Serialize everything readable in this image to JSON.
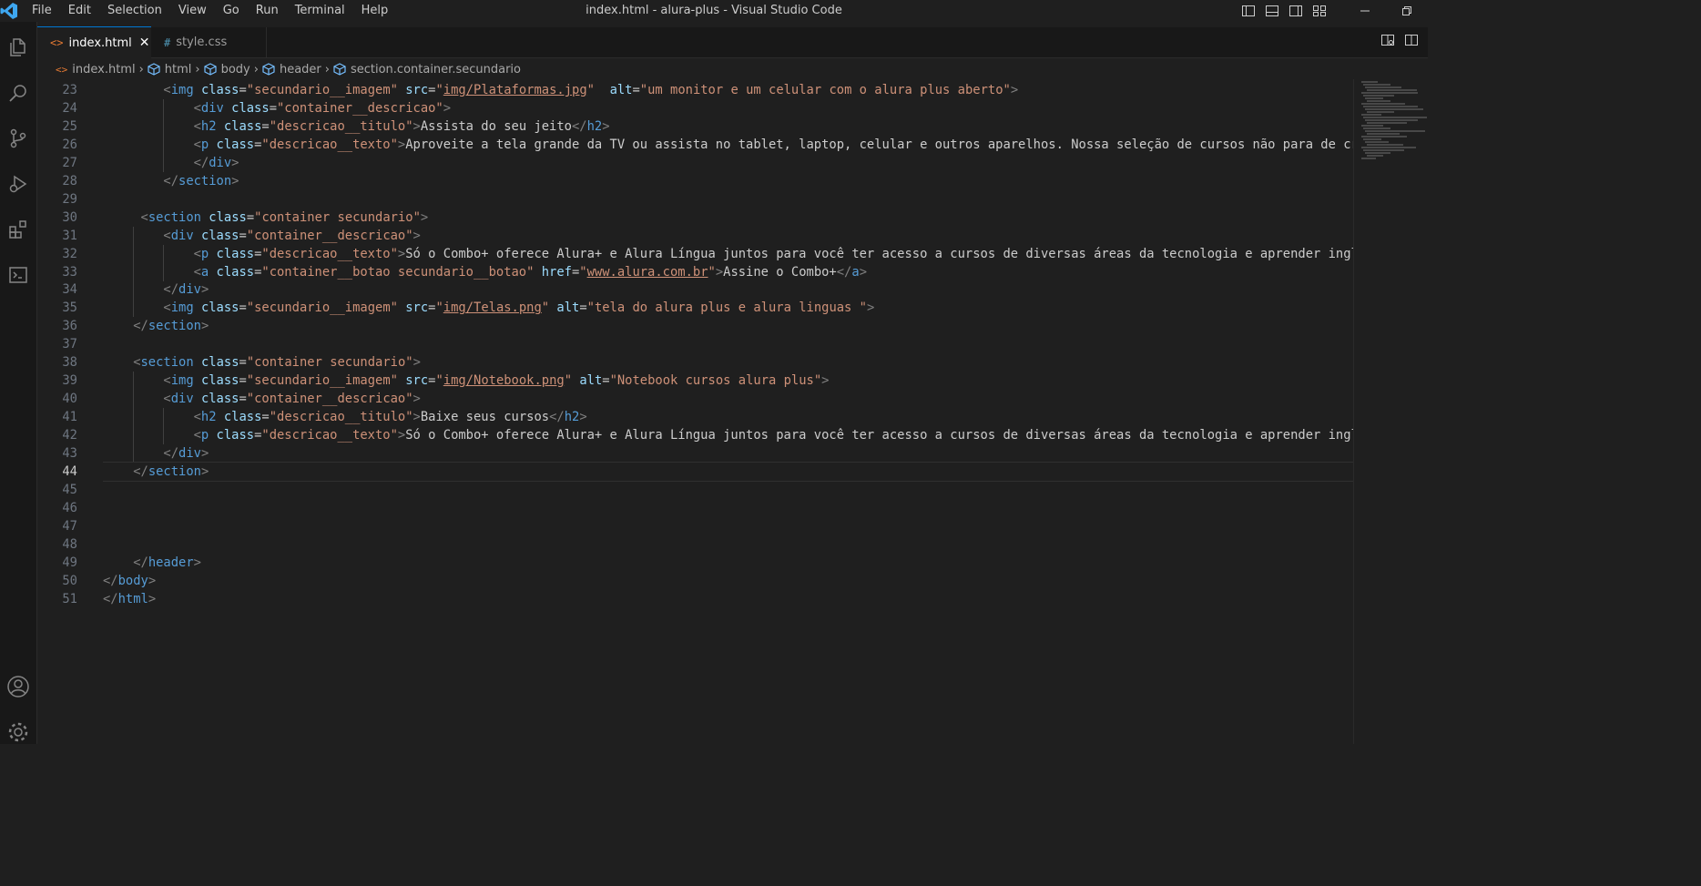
{
  "window": {
    "title": "index.html - alura-plus - Visual Studio Code"
  },
  "menu": [
    "File",
    "Edit",
    "Selection",
    "View",
    "Go",
    "Run",
    "Terminal",
    "Help"
  ],
  "tabs": [
    {
      "label": "index.html",
      "icon": "<>",
      "active": true
    },
    {
      "label": "style.css",
      "icon": "#",
      "active": false
    }
  ],
  "breadcrumbs": [
    "index.html",
    "html",
    "body",
    "header",
    "section.container.secundario"
  ],
  "editor": {
    "current_line": 44,
    "lines": [
      {
        "n": "23",
        "segs": [
          [
            "br",
            "<"
          ],
          [
            "tag",
            "img"
          ],
          [
            "txt",
            " "
          ],
          [
            "attr",
            "class"
          ],
          [
            "txt",
            "="
          ],
          [
            "str",
            "\"secundario__imagem\""
          ],
          [
            "txt",
            " "
          ],
          [
            "attr",
            "src"
          ],
          [
            "txt",
            "="
          ],
          [
            "str",
            "\""
          ],
          [
            "link",
            "img/Plataformas.jpg"
          ],
          [
            "str",
            "\""
          ],
          [
            "txt",
            "  "
          ],
          [
            "attr",
            "alt"
          ],
          [
            "txt",
            "="
          ],
          [
            "str",
            "\"um monitor e um celular com o alura plus aberto\""
          ],
          [
            "br",
            ">"
          ]
        ]
      },
      {
        "n": "24",
        "segs": [
          [
            "br",
            "<"
          ],
          [
            "tag",
            "div"
          ],
          [
            "txt",
            " "
          ],
          [
            "attr",
            "class"
          ],
          [
            "txt",
            "="
          ],
          [
            "str",
            "\"container__descricao\""
          ],
          [
            "br",
            ">"
          ]
        ]
      },
      {
        "n": "25",
        "segs": [
          [
            "br",
            "<"
          ],
          [
            "tag",
            "h2"
          ],
          [
            "txt",
            " "
          ],
          [
            "attr",
            "class"
          ],
          [
            "txt",
            "="
          ],
          [
            "str",
            "\"descricao__titulo\""
          ],
          [
            "br",
            ">"
          ],
          [
            "txt",
            "Assista do seu jeito"
          ],
          [
            "br",
            "</"
          ],
          [
            "tag",
            "h2"
          ],
          [
            "br",
            ">"
          ]
        ]
      },
      {
        "n": "26",
        "segs": [
          [
            "br",
            "<"
          ],
          [
            "tag",
            "p"
          ],
          [
            "txt",
            " "
          ],
          [
            "attr",
            "class"
          ],
          [
            "txt",
            "="
          ],
          [
            "str",
            "\"descricao__texto\""
          ],
          [
            "br",
            ">"
          ],
          [
            "txt",
            "Aproveite a tela grande da TV ou assista no tablet, laptop, celular e outros aparelhos. Nossa seleção de cursos não para de crescer"
          ]
        ]
      },
      {
        "n": "27",
        "segs": [
          [
            "br",
            "</"
          ],
          [
            "tag",
            "div"
          ],
          [
            "br",
            ">"
          ]
        ]
      },
      {
        "n": "28",
        "segs": [
          [
            "br",
            "</"
          ],
          [
            "tag",
            "section"
          ],
          [
            "br",
            ">"
          ]
        ]
      },
      {
        "n": "29",
        "segs": []
      },
      {
        "n": "30",
        "segs": [
          [
            "br",
            "<"
          ],
          [
            "tag",
            "section"
          ],
          [
            "txt",
            " "
          ],
          [
            "attr",
            "class"
          ],
          [
            "txt",
            "="
          ],
          [
            "str",
            "\"container secundario\""
          ],
          [
            "br",
            ">"
          ]
        ]
      },
      {
        "n": "31",
        "segs": [
          [
            "br",
            "<"
          ],
          [
            "tag",
            "div"
          ],
          [
            "txt",
            " "
          ],
          [
            "attr",
            "class"
          ],
          [
            "txt",
            "="
          ],
          [
            "str",
            "\"container__descricao\""
          ],
          [
            "br",
            ">"
          ]
        ]
      },
      {
        "n": "32",
        "segs": [
          [
            "br",
            "<"
          ],
          [
            "tag",
            "p"
          ],
          [
            "txt",
            " "
          ],
          [
            "attr",
            "class"
          ],
          [
            "txt",
            "="
          ],
          [
            "str",
            "\"descricao__texto\""
          ],
          [
            "br",
            ">"
          ],
          [
            "txt",
            "Só o Combo+ oferece Alura+ e Alura Língua juntos para você ter acesso a cursos de diversas áreas da tecnologia e aprender inglês ou"
          ]
        ]
      },
      {
        "n": "33",
        "segs": [
          [
            "br",
            "<"
          ],
          [
            "tag",
            "a"
          ],
          [
            "txt",
            " "
          ],
          [
            "attr",
            "class"
          ],
          [
            "txt",
            "="
          ],
          [
            "str",
            "\"container__botao secundario__botao\""
          ],
          [
            "txt",
            " "
          ],
          [
            "attr",
            "href"
          ],
          [
            "txt",
            "="
          ],
          [
            "str",
            "\""
          ],
          [
            "link",
            "www.alura.com.br"
          ],
          [
            "str",
            "\""
          ],
          [
            "br",
            ">"
          ],
          [
            "txt",
            "Assine o Combo+"
          ],
          [
            "br",
            "</"
          ],
          [
            "tag",
            "a"
          ],
          [
            "br",
            ">"
          ]
        ]
      },
      {
        "n": "34",
        "segs": [
          [
            "br",
            "</"
          ],
          [
            "tag",
            "div"
          ],
          [
            "br",
            ">"
          ]
        ]
      },
      {
        "n": "35",
        "segs": [
          [
            "br",
            "<"
          ],
          [
            "tag",
            "img"
          ],
          [
            "txt",
            " "
          ],
          [
            "attr",
            "class"
          ],
          [
            "txt",
            "="
          ],
          [
            "str",
            "\"secundario__imagem\""
          ],
          [
            "txt",
            " "
          ],
          [
            "attr",
            "src"
          ],
          [
            "txt",
            "="
          ],
          [
            "str",
            "\""
          ],
          [
            "link",
            "img/Telas.png"
          ],
          [
            "str",
            "\""
          ],
          [
            "txt",
            " "
          ],
          [
            "attr",
            "alt"
          ],
          [
            "txt",
            "="
          ],
          [
            "str",
            "\"tela do alura plus e alura linguas \""
          ],
          [
            "br",
            ">"
          ]
        ]
      },
      {
        "n": "36",
        "segs": [
          [
            "br",
            "</"
          ],
          [
            "tag",
            "section"
          ],
          [
            "br",
            ">"
          ]
        ]
      },
      {
        "n": "37",
        "segs": []
      },
      {
        "n": "38",
        "segs": [
          [
            "br",
            "<"
          ],
          [
            "tag",
            "section"
          ],
          [
            "txt",
            " "
          ],
          [
            "attr",
            "class"
          ],
          [
            "txt",
            "="
          ],
          [
            "str",
            "\"container secundario\""
          ],
          [
            "br",
            ">"
          ]
        ]
      },
      {
        "n": "39",
        "segs": [
          [
            "br",
            "<"
          ],
          [
            "tag",
            "img"
          ],
          [
            "txt",
            " "
          ],
          [
            "attr",
            "class"
          ],
          [
            "txt",
            "="
          ],
          [
            "str",
            "\"secundario__imagem\""
          ],
          [
            "txt",
            " "
          ],
          [
            "attr",
            "src"
          ],
          [
            "txt",
            "="
          ],
          [
            "str",
            "\""
          ],
          [
            "link",
            "img/Notebook.png"
          ],
          [
            "str",
            "\""
          ],
          [
            "txt",
            " "
          ],
          [
            "attr",
            "alt"
          ],
          [
            "txt",
            "="
          ],
          [
            "str",
            "\"Notebook cursos alura plus\""
          ],
          [
            "br",
            ">"
          ]
        ]
      },
      {
        "n": "40",
        "segs": [
          [
            "br",
            "<"
          ],
          [
            "tag",
            "div"
          ],
          [
            "txt",
            " "
          ],
          [
            "attr",
            "class"
          ],
          [
            "txt",
            "="
          ],
          [
            "str",
            "\"container__descricao\""
          ],
          [
            "br",
            ">"
          ]
        ]
      },
      {
        "n": "41",
        "segs": [
          [
            "br",
            "<"
          ],
          [
            "tag",
            "h2"
          ],
          [
            "txt",
            " "
          ],
          [
            "attr",
            "class"
          ],
          [
            "txt",
            "="
          ],
          [
            "str",
            "\"descricao__titulo\""
          ],
          [
            "br",
            ">"
          ],
          [
            "txt",
            "Baixe seus cursos"
          ],
          [
            "br",
            "</"
          ],
          [
            "tag",
            "h2"
          ],
          [
            "br",
            ">"
          ]
        ]
      },
      {
        "n": "42",
        "segs": [
          [
            "br",
            "<"
          ],
          [
            "tag",
            "p"
          ],
          [
            "txt",
            " "
          ],
          [
            "attr",
            "class"
          ],
          [
            "txt",
            "="
          ],
          [
            "str",
            "\"descricao__texto\""
          ],
          [
            "br",
            ">"
          ],
          [
            "txt",
            "Só o Combo+ oferece Alura+ e Alura Língua juntos para você ter acesso a cursos de diversas áreas da tecnologia e aprender inglês ou"
          ]
        ]
      },
      {
        "n": "43",
        "segs": [
          [
            "br",
            "</"
          ],
          [
            "tag",
            "div"
          ],
          [
            "br",
            ">"
          ]
        ]
      },
      {
        "n": "44",
        "segs": [
          [
            "br",
            "</"
          ],
          [
            "tag",
            "section"
          ],
          [
            "br",
            ">"
          ]
        ]
      },
      {
        "n": "45",
        "segs": []
      },
      {
        "n": "46",
        "segs": []
      },
      {
        "n": "47",
        "segs": []
      },
      {
        "n": "48",
        "segs": []
      },
      {
        "n": "49",
        "segs": [
          [
            "br",
            "</"
          ],
          [
            "tag",
            "header"
          ],
          [
            "br",
            ">"
          ]
        ]
      },
      {
        "n": "50",
        "segs": [
          [
            "br",
            "</"
          ],
          [
            "tag",
            "body"
          ],
          [
            "br",
            ">"
          ]
        ]
      },
      {
        "n": "51",
        "segs": [
          [
            "br",
            "</"
          ],
          [
            "tag",
            "html"
          ],
          [
            "br",
            ">"
          ]
        ]
      }
    ]
  },
  "colors": {
    "background": "#1f1f1f",
    "tag": "#569cd6",
    "attribute": "#9cdcfe",
    "string": "#ce9178",
    "bracket": "#808080",
    "text": "#cccccc",
    "line_number": "#6e7681",
    "active_tab_border": "#0078d4"
  }
}
